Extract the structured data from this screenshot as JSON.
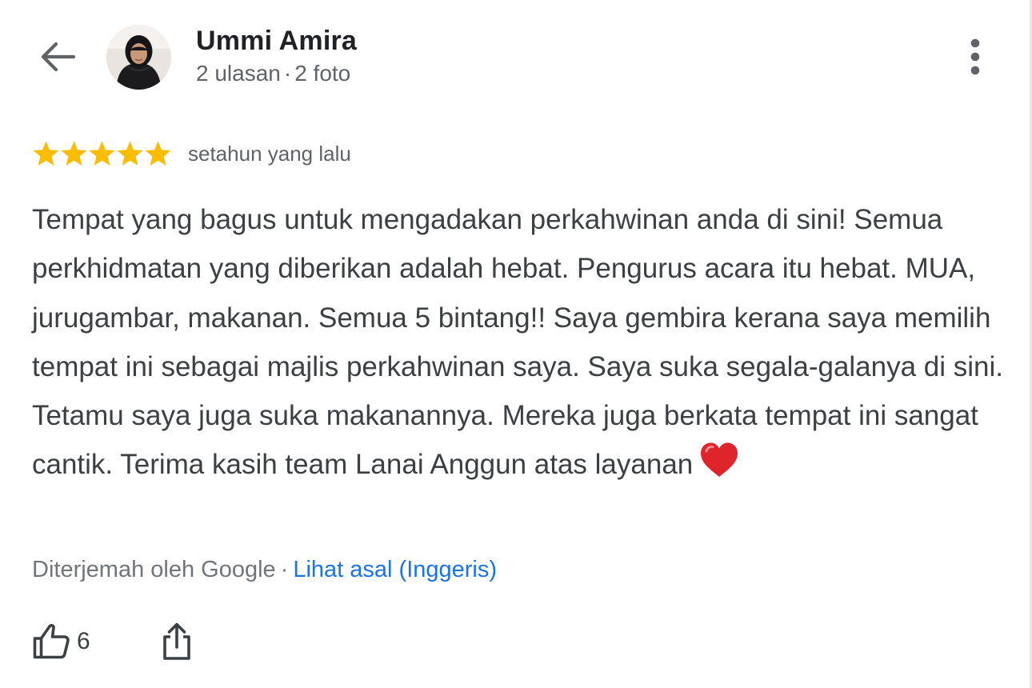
{
  "header": {
    "back_icon": "arrow-back-icon",
    "reviewer_name": "Ummi Amira",
    "review_count": "2 ulasan",
    "meta_separator": "·",
    "photo_count": "2 foto",
    "more_icon": "more-vert-icon"
  },
  "review": {
    "rating": 5,
    "max_rating": 5,
    "star_color": "#fbbc04",
    "time_ago": "setahun yang lalu",
    "text": "Tempat yang bagus untuk mengadakan perkahwinan anda di sini! Semua perkhidmatan yang diberikan adalah hebat. Pengurus acara itu hebat. MUA, jurugambar, makanan. Semua 5 bintang!! Saya gembira kerana saya memilih tempat ini sebagai majlis perkahwinan saya. Saya suka segala-galanya di sini. Tetamu saya juga suka makanannya. Mereka juga berkata tempat ini sangat cantik. Terima kasih team Lanai Anggun atas layanan",
    "emoji_icon": "red-heart-icon"
  },
  "translation": {
    "note": "Diterjemah oleh Google",
    "separator": "·",
    "view_original": "Lihat asal (Inggeris)",
    "link_color": "#1a73e8"
  },
  "actions": {
    "like_icon": "thumbs-up-icon",
    "like_count": "6",
    "share_icon": "share-icon"
  }
}
